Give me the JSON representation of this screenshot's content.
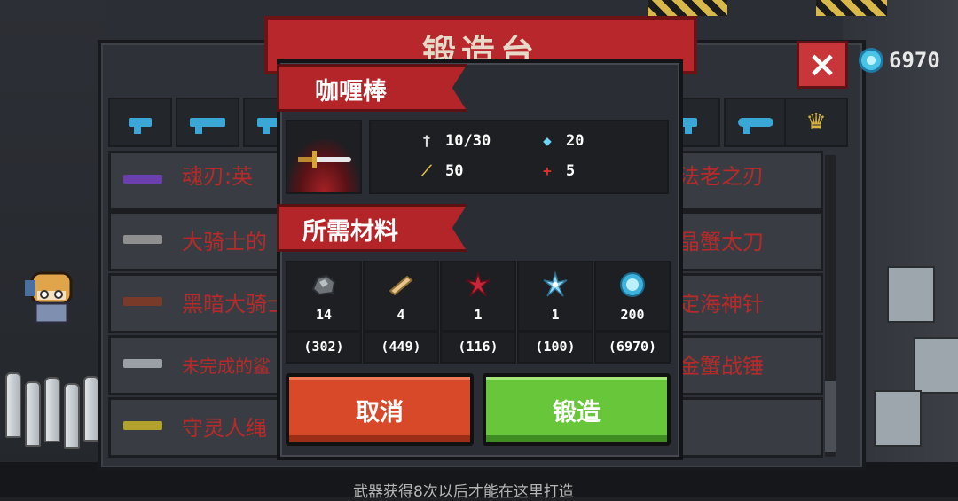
{
  "header": {
    "title": "锻造台",
    "gem_count": "6970",
    "close_icon": "×"
  },
  "weapon_list": {
    "left": [
      "魂刃:英",
      "大骑士的",
      "黑暗大骑士",
      "未完成的鲨",
      "守灵人绳"
    ],
    "right": [
      "法老之刃",
      "晶蟹太刀",
      "定海神针",
      "金蟹战锤",
      ""
    ]
  },
  "footer": {
    "note": "武器获得8次以后才能在这里打造"
  },
  "dialog": {
    "weapon_name": "咖喱棒",
    "stats": {
      "damage": "10/30",
      "energy": "20",
      "crit": "50",
      "accuracy": "5"
    },
    "materials_title": "所需材料",
    "materials": [
      {
        "icon": "iron-ore-icon",
        "required": "14",
        "owned": "(302)"
      },
      {
        "icon": "wood-plank-icon",
        "required": "4",
        "owned": "(449)"
      },
      {
        "icon": "red-crystal-icon",
        "required": "1",
        "owned": "(116)"
      },
      {
        "icon": "ice-crystal-icon",
        "required": "1",
        "owned": "(100)"
      },
      {
        "icon": "gem-icon",
        "required": "200",
        "owned": "(6970)"
      }
    ],
    "cancel_label": "取消",
    "forge_label": "锻造"
  },
  "colors": {
    "banner_red": "#b4252a",
    "cancel_orange": "#d8492a",
    "forge_green": "#68c63a",
    "weapon_text_red": "#b82a2a"
  }
}
